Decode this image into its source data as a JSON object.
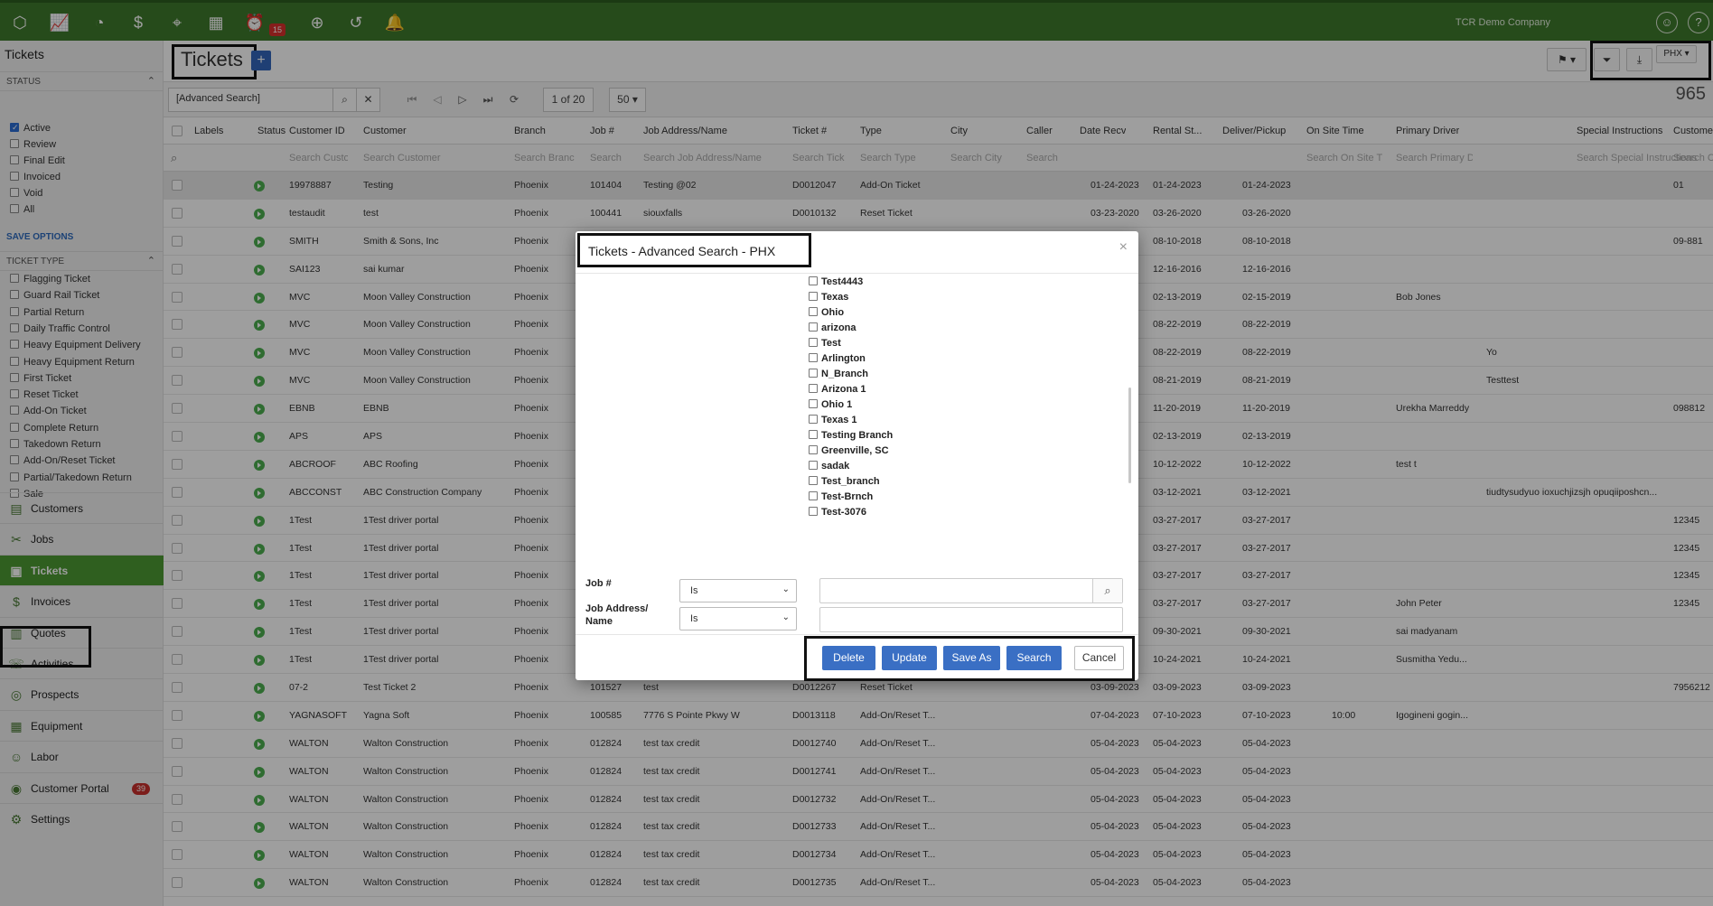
{
  "topbar": {
    "alarm_badge": "15",
    "company": "TCR Demo Company"
  },
  "sidebar": {
    "title": "Tickets",
    "status_header": "Status",
    "status_items": [
      {
        "label": "Active",
        "checked": true
      },
      {
        "label": "Review",
        "checked": false
      },
      {
        "label": "Final Edit",
        "checked": false
      },
      {
        "label": "Invoiced",
        "checked": false
      },
      {
        "label": "Void",
        "checked": false
      },
      {
        "label": "All",
        "checked": false
      }
    ],
    "save_options": "SAVE OPTIONS",
    "type_header": "Ticket Type",
    "type_items": [
      "Flagging Ticket",
      "Guard Rail Ticket",
      "Partial Return",
      "Daily Traffic Control",
      "Heavy Equipment Delivery",
      "Heavy Equipment Return",
      "First Ticket",
      "Reset Ticket",
      "Add-On Ticket",
      "Complete Return",
      "Takedown Return",
      "Add-On/Reset Ticket",
      "Partial/Takedown Return",
      "Sale"
    ],
    "nav": [
      {
        "label": "Customers",
        "icon": "customers-icon",
        "glyph": "▤"
      },
      {
        "label": "Jobs",
        "icon": "jobs-icon",
        "glyph": "✂"
      },
      {
        "label": "Tickets",
        "icon": "tickets-icon",
        "glyph": "▣",
        "active": true
      },
      {
        "label": "Invoices",
        "icon": "invoices-icon",
        "glyph": "$"
      },
      {
        "label": "Quotes",
        "icon": "quotes-icon",
        "glyph": "▥"
      },
      {
        "label": "Activities",
        "icon": "activities-icon",
        "glyph": "☏"
      },
      {
        "label": "Prospects",
        "icon": "prospects-icon",
        "glyph": "◎"
      },
      {
        "label": "Equipment",
        "icon": "equipment-icon",
        "glyph": "▦"
      },
      {
        "label": "Labor",
        "icon": "labor-icon",
        "glyph": "☺"
      },
      {
        "label": "Customer Portal",
        "icon": "portal-icon",
        "glyph": "◉",
        "badge": "39"
      },
      {
        "label": "Settings",
        "icon": "settings-icon",
        "glyph": "⚙"
      }
    ]
  },
  "header": {
    "title": "Tickets",
    "add_label": "+",
    "branch_label": "PHX"
  },
  "toolbar": {
    "search_value": "[Advanced Search]",
    "page_label": "1 of 20",
    "page_size": "50",
    "total_count": "965"
  },
  "columns": [
    "Labels",
    "Status",
    "Customer ID",
    "Customer",
    "Branch",
    "Job #",
    "Job Address/Name",
    "Ticket #",
    "Type",
    "City",
    "Caller",
    "Date Recv",
    "Rental St...",
    "Deliver/Pickup",
    "On Site Time",
    "Primary Driver",
    "Special Instructions",
    "Custome"
  ],
  "search_placeholders": [
    "Search Custo",
    "Search Customer",
    "Search Branc",
    "Search",
    "Search Job Address/Name",
    "Search Tick",
    "Search Type",
    "Search City",
    "Search",
    "Search On Site T",
    "Search Primary D",
    "Search Special Instructions",
    "Search C"
  ],
  "rows": [
    {
      "cid": "19978887",
      "customer": "Testing",
      "branch": "Phoenix",
      "job": "101404",
      "addr": "Testing @02",
      "ticket": "D0012047",
      "type": "Add-On Ticket",
      "recv": "01-24-2023",
      "rental": "01-24-2023",
      "deliver": "01-24-2023",
      "onsite": "",
      "driver": "",
      "special": "",
      "cust": "01"
    },
    {
      "cid": "testaudit",
      "customer": "test",
      "branch": "Phoenix",
      "job": "100441",
      "addr": "siouxfalls",
      "ticket": "D0010132",
      "type": "Reset Ticket",
      "recv": "03-23-2020",
      "rental": "03-26-2020",
      "deliver": "03-26-2020",
      "onsite": "",
      "driver": "",
      "special": "",
      "cust": ""
    },
    {
      "cid": "SMITH",
      "customer": "Smith & Sons, Inc",
      "branch": "Phoenix",
      "job": "",
      "addr": "",
      "ticket": "",
      "type": "",
      "recv": "",
      "rental": "08-10-2018",
      "deliver": "08-10-2018",
      "onsite": "",
      "driver": "",
      "special": "",
      "cust": "09-881"
    },
    {
      "cid": "SAI123",
      "customer": "sai kumar",
      "branch": "Phoenix",
      "job": "",
      "addr": "",
      "ticket": "",
      "type": "",
      "recv": "",
      "rental": "12-16-2016",
      "deliver": "12-16-2016",
      "onsite": "",
      "driver": "",
      "special": "",
      "cust": ""
    },
    {
      "cid": "MVC",
      "customer": "Moon Valley Construction",
      "branch": "Phoenix",
      "job": "",
      "addr": "",
      "ticket": "",
      "type": "",
      "recv": "",
      "rental": "02-13-2019",
      "deliver": "02-15-2019",
      "onsite": "",
      "driver": "Bob Jones",
      "special": "",
      "cust": ""
    },
    {
      "cid": "MVC",
      "customer": "Moon Valley Construction",
      "branch": "Phoenix",
      "job": "",
      "addr": "",
      "ticket": "",
      "type": "",
      "recv": "",
      "rental": "08-22-2019",
      "deliver": "08-22-2019",
      "onsite": "",
      "driver": "",
      "special": "",
      "cust": ""
    },
    {
      "cid": "MVC",
      "customer": "Moon Valley Construction",
      "branch": "Phoenix",
      "job": "",
      "addr": "",
      "ticket": "",
      "type": "",
      "recv": "",
      "rental": "08-22-2019",
      "deliver": "08-22-2019",
      "onsite": "",
      "driver": "",
      "special": "Yo",
      "cust": ""
    },
    {
      "cid": "MVC",
      "customer": "Moon Valley Construction",
      "branch": "Phoenix",
      "job": "",
      "addr": "",
      "ticket": "",
      "type": "",
      "recv": "",
      "rental": "08-21-2019",
      "deliver": "08-21-2019",
      "onsite": "",
      "driver": "",
      "special": "Testtest",
      "cust": ""
    },
    {
      "cid": "EBNB",
      "customer": "EBNB",
      "branch": "Phoenix",
      "job": "",
      "addr": "",
      "ticket": "",
      "type": "",
      "recv": "",
      "rental": "11-20-2019",
      "deliver": "11-20-2019",
      "onsite": "",
      "driver": "Urekha Marreddy",
      "special": "",
      "cust": "098812"
    },
    {
      "cid": "APS",
      "customer": "APS",
      "branch": "Phoenix",
      "job": "",
      "addr": "",
      "ticket": "",
      "type": "",
      "recv": "",
      "rental": "02-13-2019",
      "deliver": "02-13-2019",
      "onsite": "",
      "driver": "",
      "special": "",
      "cust": ""
    },
    {
      "cid": "ABCROOF",
      "customer": "ABC Roofing",
      "branch": "Phoenix",
      "job": "",
      "addr": "",
      "ticket": "",
      "type": "",
      "recv": "",
      "rental": "10-12-2022",
      "deliver": "10-12-2022",
      "onsite": "",
      "driver": "test t",
      "special": "",
      "cust": ""
    },
    {
      "cid": "ABCCONST",
      "customer": "ABC Construction Company",
      "branch": "Phoenix",
      "job": "",
      "addr": "",
      "ticket": "",
      "type": "",
      "recv": "",
      "rental": "03-12-2021",
      "deliver": "03-12-2021",
      "onsite": "",
      "driver": "",
      "special": "tiudtysudyuo ioxuchjizsjh opuqiiposhcn...",
      "cust": ""
    },
    {
      "cid": "1Test",
      "customer": "1Test driver portal",
      "branch": "Phoenix",
      "job": "",
      "addr": "",
      "ticket": "",
      "type": "",
      "recv": "",
      "rental": "03-27-2017",
      "deliver": "03-27-2017",
      "onsite": "",
      "driver": "",
      "special": "",
      "cust": "12345"
    },
    {
      "cid": "1Test",
      "customer": "1Test driver portal",
      "branch": "Phoenix",
      "job": "",
      "addr": "",
      "ticket": "",
      "type": "",
      "recv": "",
      "rental": "03-27-2017",
      "deliver": "03-27-2017",
      "onsite": "",
      "driver": "",
      "special": "",
      "cust": "12345"
    },
    {
      "cid": "1Test",
      "customer": "1Test driver portal",
      "branch": "Phoenix",
      "job": "",
      "addr": "",
      "ticket": "",
      "type": "",
      "recv": "",
      "rental": "03-27-2017",
      "deliver": "03-27-2017",
      "onsite": "",
      "driver": "",
      "special": "",
      "cust": "12345"
    },
    {
      "cid": "1Test",
      "customer": "1Test driver portal",
      "branch": "Phoenix",
      "job": "",
      "addr": "",
      "ticket": "",
      "type": "",
      "recv": "",
      "rental": "03-27-2017",
      "deliver": "03-27-2017",
      "onsite": "",
      "driver": "John Peter",
      "special": "",
      "cust": "12345"
    },
    {
      "cid": "1Test",
      "customer": "1Test driver portal",
      "branch": "Phoenix",
      "job": "",
      "addr": "",
      "ticket": "",
      "type": "",
      "recv": "",
      "rental": "09-30-2021",
      "deliver": "09-30-2021",
      "onsite": "",
      "driver": "sai madyanam",
      "special": "",
      "cust": ""
    },
    {
      "cid": "1Test",
      "customer": "1Test driver portal",
      "branch": "Phoenix",
      "job": "",
      "addr": "",
      "ticket": "",
      "type": "",
      "recv": "",
      "rental": "10-24-2021",
      "deliver": "10-24-2021",
      "onsite": "",
      "driver": "Susmitha Yedu...",
      "special": "",
      "cust": ""
    },
    {
      "cid": "07-2",
      "customer": "Test Ticket 2",
      "branch": "Phoenix",
      "job": "101527",
      "addr": "test",
      "ticket": "D0012267",
      "type": "Reset Ticket",
      "recv": "03-09-2023",
      "rental": "03-09-2023",
      "deliver": "03-09-2023",
      "onsite": "",
      "driver": "",
      "special": "",
      "cust": "7956212"
    },
    {
      "cid": "YAGNASOFT",
      "customer": "Yagna Soft",
      "branch": "Phoenix",
      "job": "100585",
      "addr": "7776 S Pointe Pkwy W",
      "ticket": "D0013118",
      "type": "Add-On/Reset T...",
      "recv": "07-04-2023",
      "rental": "07-10-2023",
      "deliver": "07-10-2023",
      "onsite": "10:00",
      "driver": "Igogineni gogin...",
      "special": "",
      "cust": ""
    },
    {
      "cid": "WALTON",
      "customer": "Walton Construction",
      "branch": "Phoenix",
      "job": "012824",
      "addr": "test tax credit",
      "ticket": "D0012740",
      "type": "Add-On/Reset T...",
      "recv": "05-04-2023",
      "rental": "05-04-2023",
      "deliver": "05-04-2023",
      "onsite": "",
      "driver": "",
      "special": "",
      "cust": ""
    },
    {
      "cid": "WALTON",
      "customer": "Walton Construction",
      "branch": "Phoenix",
      "job": "012824",
      "addr": "test tax credit",
      "ticket": "D0012741",
      "type": "Add-On/Reset T...",
      "recv": "05-04-2023",
      "rental": "05-04-2023",
      "deliver": "05-04-2023",
      "onsite": "",
      "driver": "",
      "special": "",
      "cust": ""
    },
    {
      "cid": "WALTON",
      "customer": "Walton Construction",
      "branch": "Phoenix",
      "job": "012824",
      "addr": "test tax credit",
      "ticket": "D0012732",
      "type": "Add-On/Reset T...",
      "recv": "05-04-2023",
      "rental": "05-04-2023",
      "deliver": "05-04-2023",
      "onsite": "",
      "driver": "",
      "special": "",
      "cust": ""
    },
    {
      "cid": "WALTON",
      "customer": "Walton Construction",
      "branch": "Phoenix",
      "job": "012824",
      "addr": "test tax credit",
      "ticket": "D0012733",
      "type": "Add-On/Reset T...",
      "recv": "05-04-2023",
      "rental": "05-04-2023",
      "deliver": "05-04-2023",
      "onsite": "",
      "driver": "",
      "special": "",
      "cust": ""
    },
    {
      "cid": "WALTON",
      "customer": "Walton Construction",
      "branch": "Phoenix",
      "job": "012824",
      "addr": "test tax credit",
      "ticket": "D0012734",
      "type": "Add-On/Reset T...",
      "recv": "05-04-2023",
      "rental": "05-04-2023",
      "deliver": "05-04-2023",
      "onsite": "",
      "driver": "",
      "special": "",
      "cust": ""
    },
    {
      "cid": "WALTON",
      "customer": "Walton Construction",
      "branch": "Phoenix",
      "job": "012824",
      "addr": "test tax credit",
      "ticket": "D0012735",
      "type": "Add-On/Reset T...",
      "recv": "05-04-2023",
      "rental": "05-04-2023",
      "deliver": "05-04-2023",
      "onsite": "",
      "driver": "",
      "special": "",
      "cust": ""
    }
  ],
  "modal": {
    "title": "Tickets - Advanced Search - PHX",
    "close": "×",
    "branches": [
      "Test4443",
      "Texas",
      "Ohio",
      "arizona",
      "Test",
      "Arlington",
      "N_Branch",
      "Arizona 1",
      "Ohio 1",
      "Texas 1",
      "Testing Branch",
      "Greenville, SC",
      "sadak",
      "Test_branch",
      "Test-Brnch",
      "Test-3076"
    ],
    "job_label": "Job #",
    "job_operator": "Is",
    "job_value": "",
    "addr_label": "Job Address/\nName",
    "addr_operator": "Is",
    "addr_value": "",
    "buttons": {
      "delete": "Delete",
      "update": "Update",
      "save_as": "Save As",
      "search": "Search",
      "cancel": "Cancel"
    }
  }
}
